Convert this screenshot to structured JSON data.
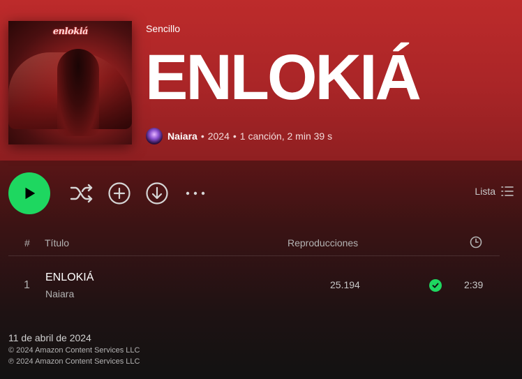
{
  "album": {
    "type_label": "Sencillo",
    "title": "ENLOKIÁ",
    "cover_logo_text": "enlokiá",
    "artist": "Naiara",
    "year": "2024",
    "summary": "1 canción, 2 min 39 s",
    "separator": "•"
  },
  "controls": {
    "play_icon": "play-icon",
    "shuffle_icon": "shuffle-icon",
    "add_icon": "add-circle-icon",
    "download_icon": "download-icon",
    "more_icon": "more-options-icon",
    "view_label": "Lista",
    "view_icon": "list-view-icon"
  },
  "table": {
    "headers": {
      "number": "#",
      "title": "Título",
      "plays": "Reproducciones",
      "duration_icon": "clock-icon"
    },
    "rows": [
      {
        "number": "1",
        "title": "ENLOKIÁ",
        "artist": "Naiara",
        "plays": "25.194",
        "downloaded": true,
        "duration": "2:39"
      }
    ]
  },
  "footer": {
    "release_date": "11 de abril de 2024",
    "copyright": "© 2024 Amazon Content Services LLC",
    "phonogram": "℗ 2024 Amazon Content Services LLC"
  },
  "colors": {
    "accent_green": "#1ed760",
    "header_red": "#b8282a",
    "background": "#121212"
  }
}
